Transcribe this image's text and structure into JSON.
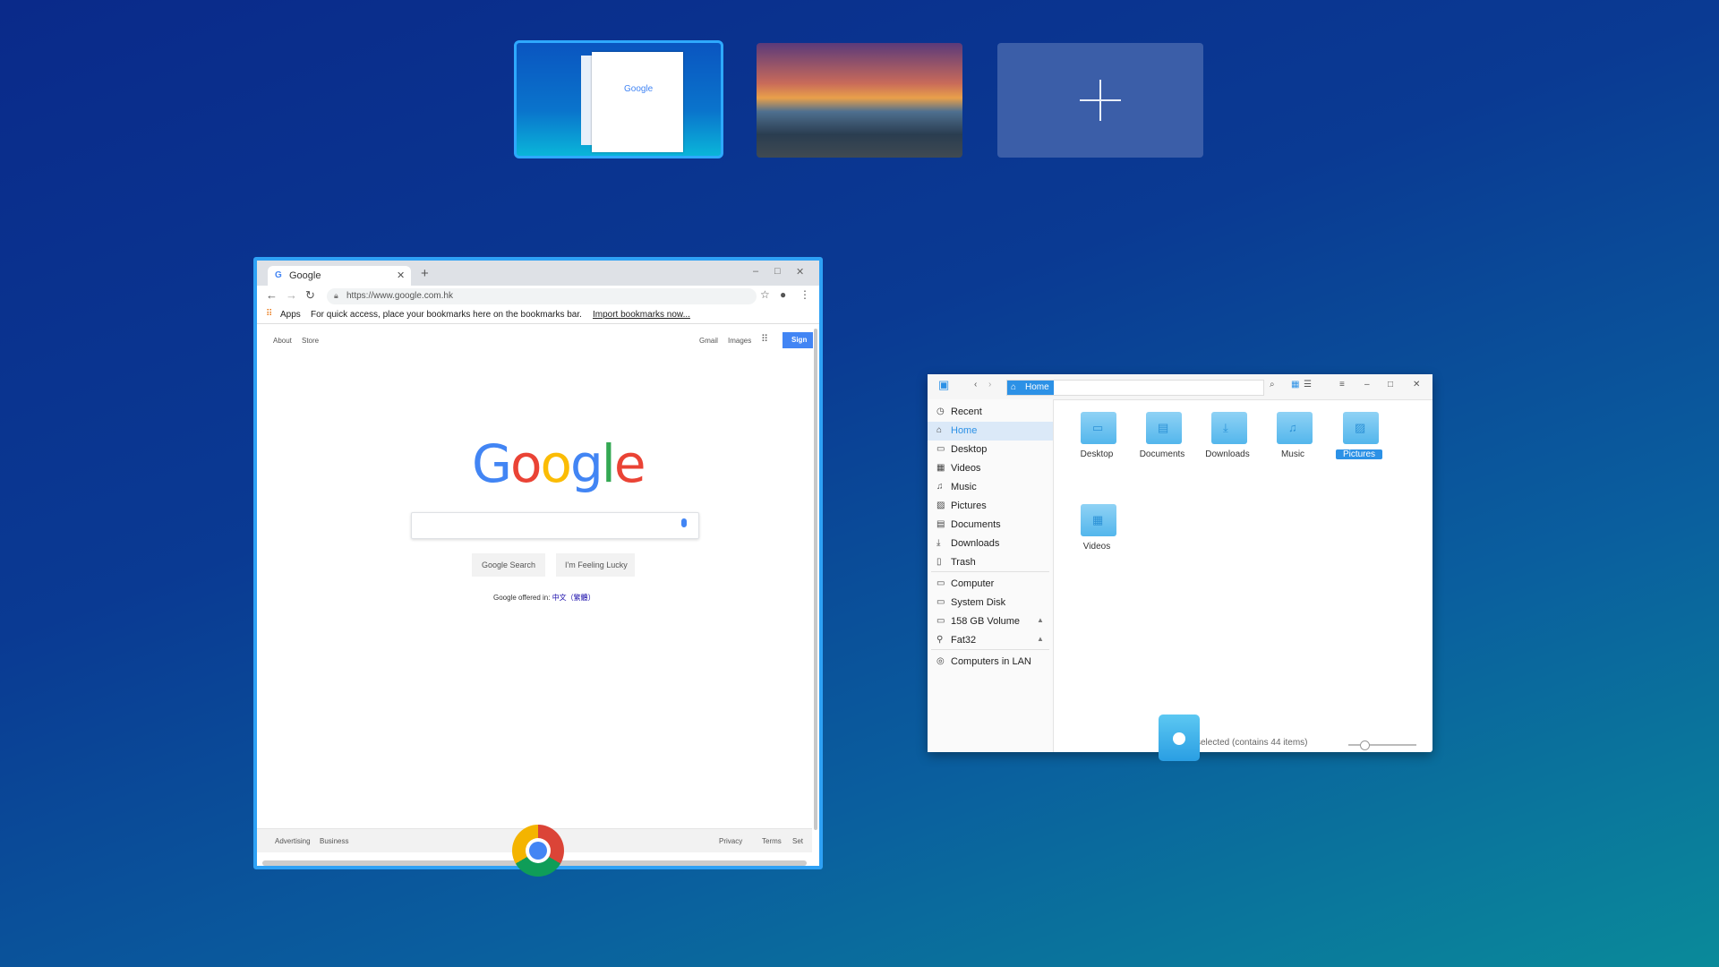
{
  "workspaces": {
    "thumb1_title": "Google",
    "add_label": "+"
  },
  "chrome": {
    "tab_title": "Google",
    "tab_favicon": "G",
    "new_tab": "+",
    "url": "https://www.google.com.hk",
    "bookmarks_apps": "Apps",
    "bookmarks_text": "For quick access, place your bookmarks here on the bookmarks bar.",
    "bookmarks_link": "Import bookmarks now...",
    "page": {
      "about": "About",
      "store": "Store",
      "gmail": "Gmail",
      "images": "Images",
      "sign_in": "Sign",
      "logo": "Google",
      "google_search": "Google Search",
      "feeling_lucky": "I'm Feeling Lucky",
      "offered_in": "Google offered in:",
      "offered_lang": "中文（繁體）",
      "footer": {
        "advertising": "Advertising",
        "business": "Business",
        "privacy": "Privacy",
        "terms": "Terms",
        "settings": "Set"
      }
    }
  },
  "file_manager": {
    "breadcrumb": "Home",
    "sidebar": [
      {
        "icon": "clock-icon",
        "glyph": "◷",
        "label": "Recent"
      },
      {
        "icon": "home-icon",
        "glyph": "⌂",
        "label": "Home",
        "active": true
      },
      {
        "icon": "desktop-icon",
        "glyph": "▭",
        "label": "Desktop"
      },
      {
        "icon": "video-icon",
        "glyph": "▦",
        "label": "Videos"
      },
      {
        "icon": "music-icon",
        "glyph": "♫",
        "label": "Music"
      },
      {
        "icon": "picture-icon",
        "glyph": "▨",
        "label": "Pictures"
      },
      {
        "icon": "document-icon",
        "glyph": "▤",
        "label": "Documents"
      },
      {
        "icon": "download-icon",
        "glyph": "⤓",
        "label": "Downloads"
      },
      {
        "icon": "trash-icon",
        "glyph": "▯",
        "label": "Trash"
      },
      {
        "icon": "computer-icon",
        "glyph": "▭",
        "label": "Computer"
      },
      {
        "icon": "disk-icon",
        "glyph": "▭",
        "label": "System Disk"
      },
      {
        "icon": "disk-icon",
        "glyph": "▭",
        "label": "158 GB Volume",
        "eject": true
      },
      {
        "icon": "usb-icon",
        "glyph": "⚲",
        "label": "Fat32",
        "eject": true
      },
      {
        "icon": "network-icon",
        "glyph": "◎",
        "label": "Computers in LAN"
      }
    ],
    "folders": [
      {
        "label": "Desktop",
        "glyph": "▭"
      },
      {
        "label": "Documents",
        "glyph": "▤"
      },
      {
        "label": "Downloads",
        "glyph": "⤓"
      },
      {
        "label": "Music",
        "glyph": "♫"
      },
      {
        "label": "Pictures",
        "glyph": "▨",
        "selected": true
      },
      {
        "label": "Videos",
        "glyph": "▦"
      }
    ],
    "status": "selected (contains 44 items)",
    "zoom_level": 0.2
  },
  "colors": {
    "accent": "#2c91e6",
    "window_border": "#2ea1f5"
  }
}
